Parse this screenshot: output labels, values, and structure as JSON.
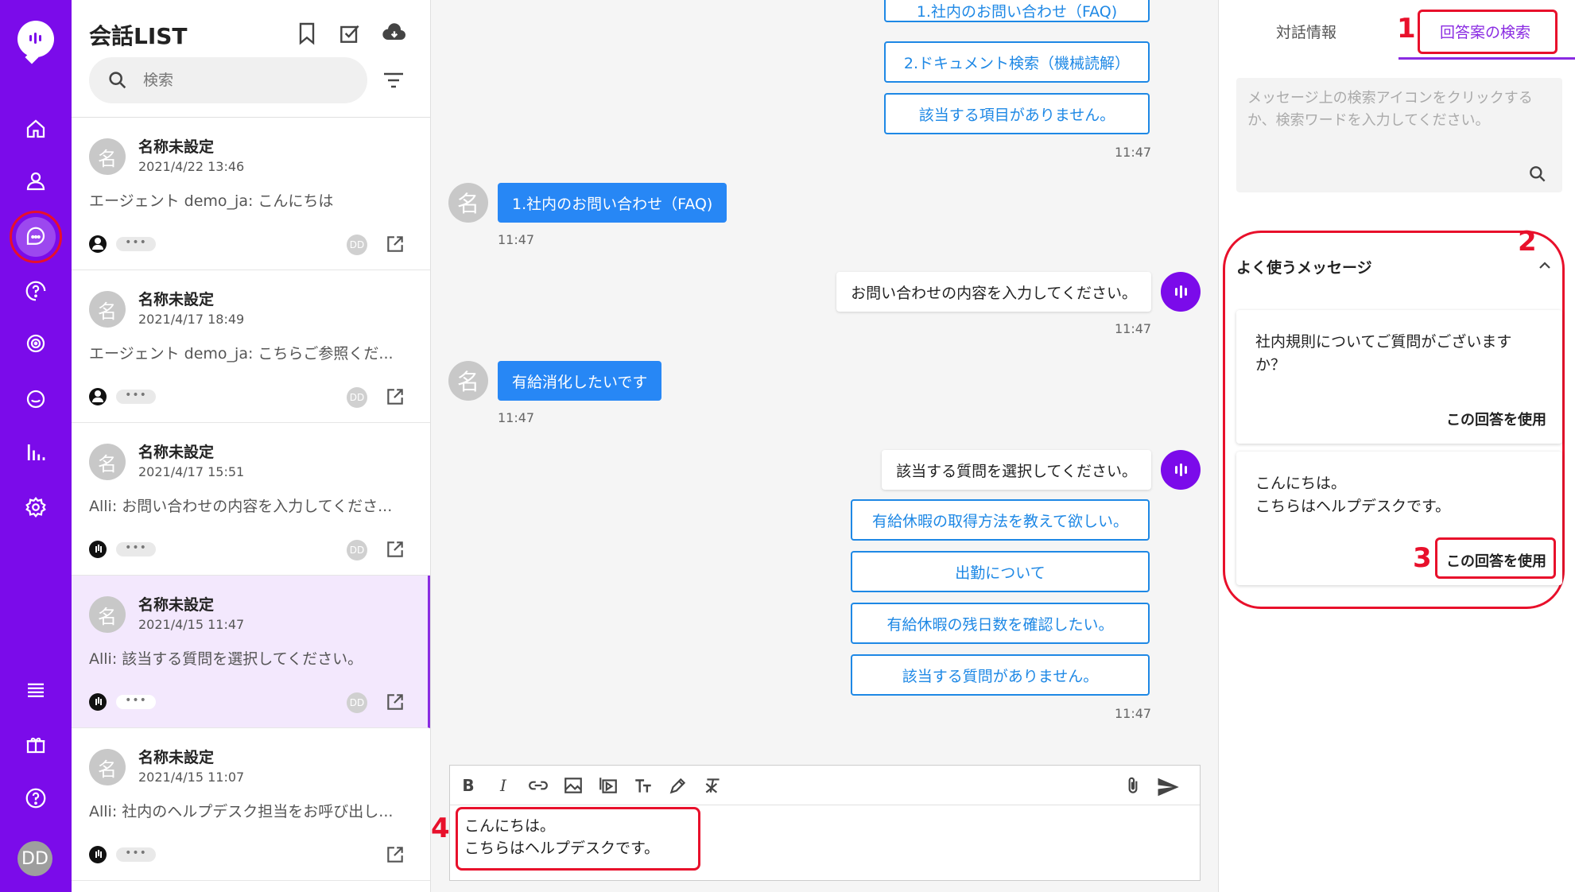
{
  "nav": {
    "items": [
      "home-icon",
      "user-icon",
      "chat-icon",
      "help-circle-icon",
      "target-icon",
      "message-icon",
      "bar-chart-icon",
      "gear-icon",
      "menu-icon",
      "gift-icon",
      "question-icon"
    ],
    "avatar": "DD"
  },
  "list": {
    "title": "会話LIST",
    "search_placeholder": "検索",
    "conversations": [
      {
        "avatar": "名",
        "name": "名称未設定",
        "time": "2021/4/22 13:46",
        "preview": "エージェント demo_ja: こんにちは",
        "status": "user",
        "dots": "•••",
        "assignee": "DD"
      },
      {
        "avatar": "名",
        "name": "名称未設定",
        "time": "2021/4/17 18:49",
        "preview": "エージェント demo_ja: こちらご参照くだ...",
        "status": "user",
        "dots": "•••",
        "assignee": "DD"
      },
      {
        "avatar": "名",
        "name": "名称未設定",
        "time": "2021/4/17 15:51",
        "preview": "Alli: お問い合わせの内容を入力してくださ...",
        "status": "bot",
        "dots": "•••",
        "assignee": "DD"
      },
      {
        "avatar": "名",
        "name": "名称未設定",
        "time": "2021/4/15 11:47",
        "preview": "Alli: 該当する質問を選択してください。",
        "status": "bot",
        "dots": "•••",
        "assignee": "DD"
      },
      {
        "avatar": "名",
        "name": "名称未設定",
        "time": "2021/4/15 11:07",
        "preview": "Alli: 社内のヘルプデスク担当をお呼び出し...",
        "status": "bot",
        "dots": "•••",
        "assignee": ""
      }
    ]
  },
  "chat": {
    "options_top": [
      "1.社内のお問い合わせ（FAQ)",
      "2.ドキュメント検索（機械読解）",
      "該当する項目がありません。"
    ],
    "time1": "11:47",
    "user_msg1": "1.社内のお問い合わせ（FAQ)",
    "user_avatar": "名",
    "time2": "11:47",
    "bot_msg1": "お問い合わせの内容を入力してください。",
    "time3": "11:47",
    "user_msg2": "有給消化したいです",
    "time4": "11:47",
    "bot_msg2": "該当する質問を選択してください。",
    "options_bottom": [
      "有給休暇の取得方法を教えて欲しい。",
      "出勤について",
      "有給休暇の残日数を確認したい。",
      "該当する質問がありません。"
    ],
    "time5": "11:47",
    "composer": {
      "toolbar": [
        "bold-icon",
        "italic-icon",
        "link-icon",
        "image-icon",
        "video-icon",
        "text-size-icon",
        "color-picker-icon",
        "clear-format-icon",
        "attachment-icon",
        "send-icon"
      ],
      "bold": "B",
      "italic": "I",
      "line1": "こんにちは。",
      "line2": "こちらはヘルプデスクです。"
    }
  },
  "side": {
    "tab1": "対話情報",
    "tab2": "回答案の検索",
    "search_placeholder": "メッセージ上の検索アイコンをクリックするか、検索ワードを入力してください。",
    "faq_title": "よく使うメッセージ",
    "cards": [
      {
        "text": "社内規則についてご質問がございますか？",
        "use": "この回答を使用"
      },
      {
        "text_line1": "こんにちは。",
        "text_line2": "こちらはヘルプデスクです。",
        "use": "この回答を使用"
      }
    ]
  },
  "annotations": {
    "n1": "1",
    "n2": "2",
    "n3": "3",
    "n4": "4"
  },
  "colors": {
    "brand": "#7b0bea",
    "accent": "#8a2be2",
    "link": "#1e88e5",
    "user_bubble": "#2787f5",
    "annotation": "#e8102b"
  }
}
